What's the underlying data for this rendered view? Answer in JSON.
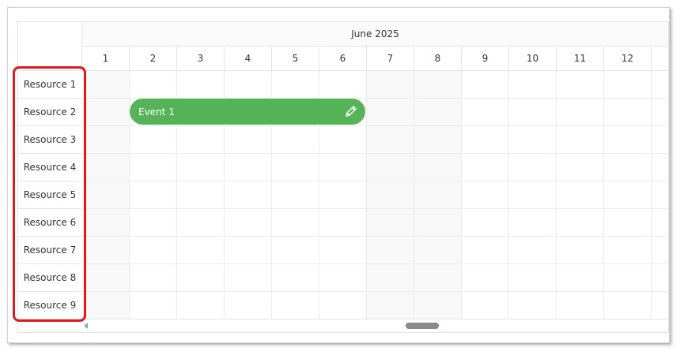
{
  "header": {
    "month": "June 2025",
    "days": [
      "1",
      "2",
      "3",
      "4",
      "5",
      "6",
      "7",
      "8",
      "9",
      "10",
      "11",
      "12"
    ]
  },
  "resources": [
    "Resource 1",
    "Resource 2",
    "Resource 3",
    "Resource 4",
    "Resource 5",
    "Resource 6",
    "Resource 7",
    "Resource 8",
    "Resource 9"
  ],
  "event": {
    "label": "Event 1",
    "resource": "Resource 2",
    "start_day": "2",
    "end_day": "6"
  },
  "colors": {
    "event": "#55b358",
    "highlight": "#e0191d",
    "grid": "#ececec",
    "weekend": "#f8f8f8"
  },
  "icons": {
    "event_edit": "pencil-icon",
    "scroll_left": "arrow-left-icon"
  }
}
